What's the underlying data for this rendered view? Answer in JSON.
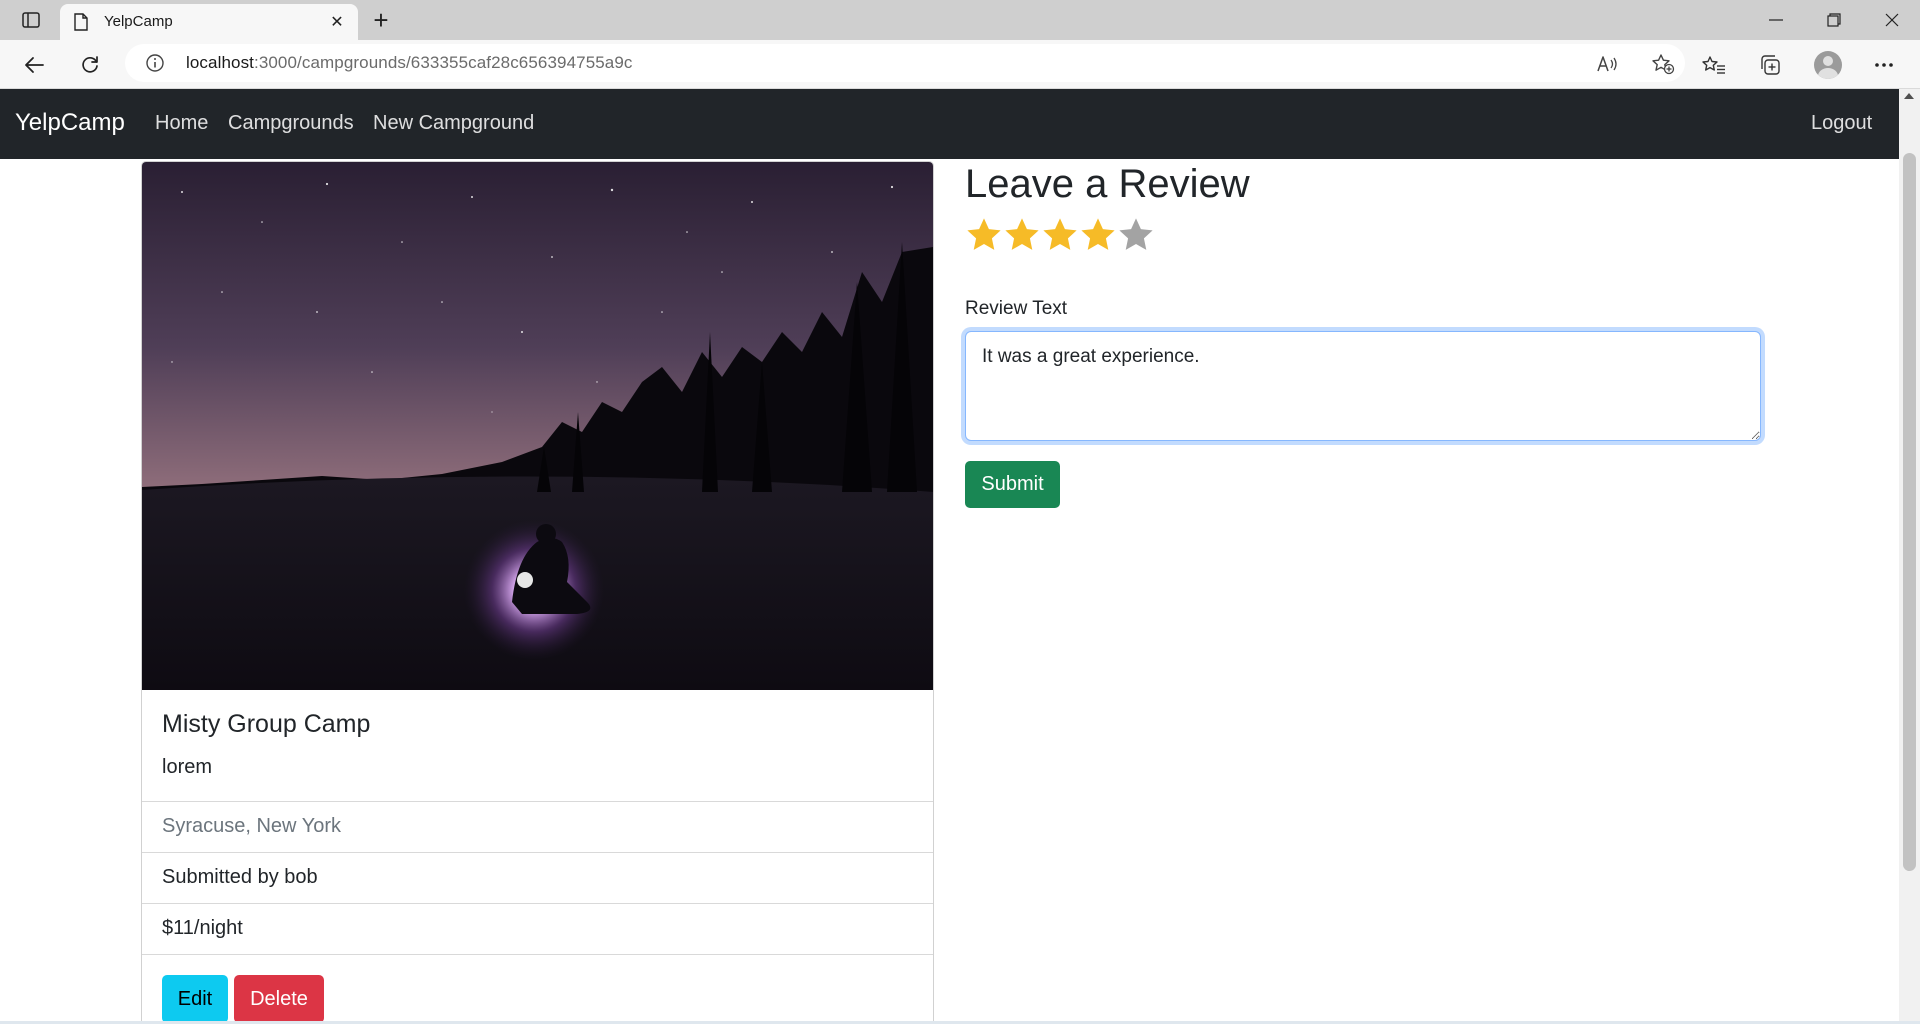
{
  "browser": {
    "tab_title": "YelpCamp",
    "url_host": "localhost",
    "url_path": ":3000/campgrounds/633355caf28c656394755a9c",
    "icons": [
      "tab-actions-icon",
      "page-favicon",
      "close-icon",
      "plus-icon",
      "minimize-icon",
      "restore-icon",
      "window-close-icon",
      "back-icon",
      "refresh-icon",
      "info-icon",
      "read-aloud-icon",
      "add-favorite-icon",
      "favorites-icon",
      "collections-icon",
      "profile-avatar",
      "more-icon"
    ]
  },
  "navbar": {
    "brand": "YelpCamp",
    "links": [
      "Home",
      "Campgrounds",
      "New Campground"
    ],
    "logout": "Logout",
    "bg_color": "#212529"
  },
  "campground": {
    "image_alt": "night camp under starry sky",
    "title": "Misty Group Camp",
    "description": "lorem",
    "location": "Syracuse, New York",
    "submitted_by": "Submitted by bob",
    "price": "$11/night",
    "edit_label": "Edit",
    "delete_label": "Delete"
  },
  "review": {
    "heading": "Leave a Review",
    "rating": 4,
    "max_rating": 5,
    "label": "Review Text",
    "text": "It was a great experience.",
    "submit_label": "Submit",
    "colors": {
      "star_filled": "#f6bb27",
      "star_empty": "#a3a3a3",
      "submit": "#198754",
      "edit": "#0dcaf0",
      "delete": "#dc3545"
    }
  }
}
